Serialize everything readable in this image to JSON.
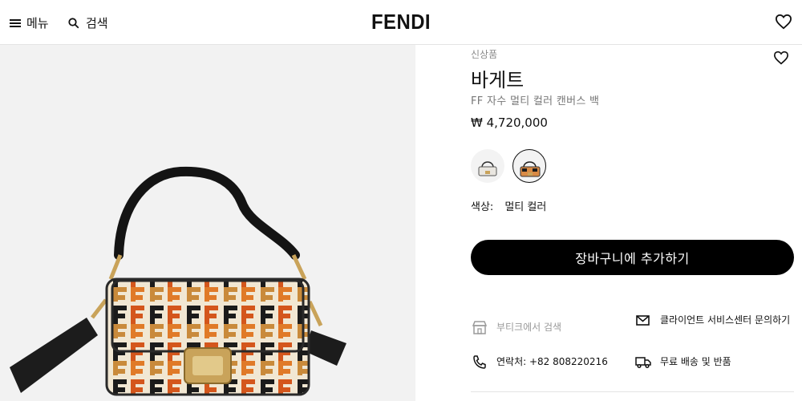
{
  "header": {
    "menu_label": "메뉴",
    "search_label": "검색",
    "logo": "FENDI"
  },
  "product": {
    "badge": "신상품",
    "title": "바게트",
    "subtitle": "FF 자수 멀티 컬러 캔버스 백",
    "price": "₩ 4,720,000",
    "color_label": "색상:",
    "color_value": "멀티 컬러",
    "cart_button": "장바구니에 추가하기"
  },
  "services": {
    "boutique": "부티크에서 검색",
    "client_service": "클라이언트 서비스센터 문의하기",
    "phone": "연락처: +82 808220216",
    "shipping": "무료 배송 및 반품"
  },
  "icons": [
    "menu-icon",
    "search-icon",
    "heart-icon",
    "store-icon",
    "mail-icon",
    "phone-icon",
    "truck-icon"
  ],
  "colors": {
    "button_bg": "#000000",
    "image_bg": "#f2f2f2",
    "muted_text": "#777777"
  }
}
